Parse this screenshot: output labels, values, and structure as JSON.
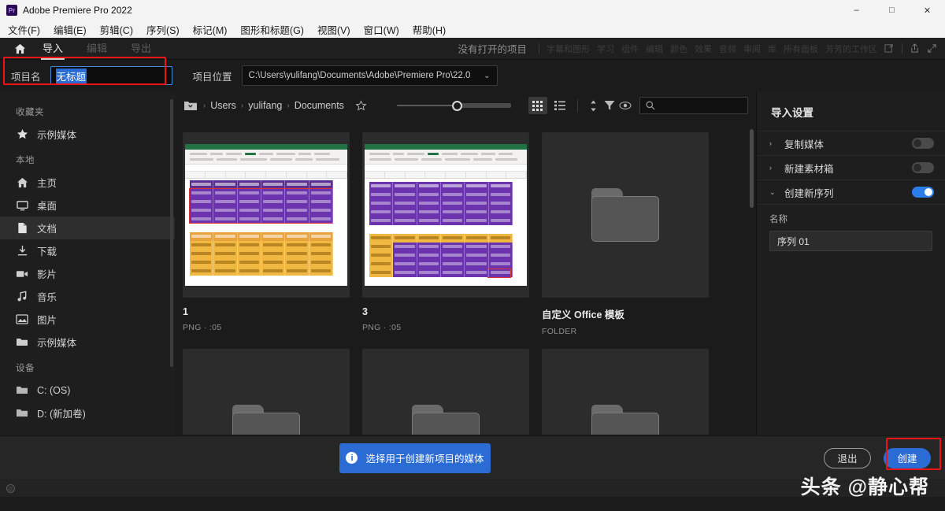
{
  "window": {
    "title": "Adobe Premiere Pro 2022",
    "logo_text": "Pr",
    "minimize": "–",
    "maximize": "□",
    "close": "✕"
  },
  "menubar": {
    "items": [
      "文件(F)",
      "编辑(E)",
      "剪辑(C)",
      "序列(S)",
      "标记(M)",
      "图形和标题(G)",
      "视图(V)",
      "窗口(W)",
      "帮助(H)"
    ]
  },
  "navbar": {
    "home_icon": "home-icon",
    "tabs": [
      {
        "label": "导入",
        "active": true
      },
      {
        "label": "编辑",
        "active": false
      },
      {
        "label": "导出",
        "active": false
      }
    ],
    "no_project_text": "没有打开的项目",
    "workspaces": [
      "字幕和图形",
      "学习",
      "组件",
      "编辑",
      "颜色",
      "效果",
      "音频",
      "审阅",
      "库",
      "所有面板",
      "芳芳的工作区"
    ]
  },
  "project_row": {
    "name_label": "项目名",
    "name_value": "无标题",
    "location_label": "项目位置",
    "location_value": "C:\\Users\\yulifang\\Documents\\Adobe\\Premiere Pro\\22.0",
    "location_chevron": "⌄"
  },
  "sidebar": {
    "sections": [
      {
        "header": "收藏夹",
        "items": [
          {
            "label": "示例媒体",
            "icon": "star-icon",
            "active": false
          }
        ]
      },
      {
        "header": "本地",
        "items": [
          {
            "label": "主页",
            "icon": "home-icon",
            "active": false
          },
          {
            "label": "桌面",
            "icon": "monitor-icon",
            "active": false
          },
          {
            "label": "文档",
            "icon": "document-icon",
            "active": true
          },
          {
            "label": "下载",
            "icon": "download-icon",
            "active": false
          },
          {
            "label": "影片",
            "icon": "video-camera-icon",
            "active": false
          },
          {
            "label": "音乐",
            "icon": "music-note-icon",
            "active": false
          },
          {
            "label": "图片",
            "icon": "image-icon",
            "active": false
          },
          {
            "label": "示例媒体",
            "icon": "folder-icon",
            "active": false
          }
        ]
      },
      {
        "header": "设备",
        "items": [
          {
            "label": "C: (OS)",
            "icon": "folder-icon",
            "active": false
          },
          {
            "label": "D: (新加卷)",
            "icon": "folder-icon",
            "active": false
          }
        ]
      }
    ]
  },
  "browser": {
    "breadcrumb": {
      "folder_icon": "folder-dropdown-icon",
      "parts": [
        "Users",
        "yulifang",
        "Documents"
      ],
      "separator": "›",
      "star_icon": "star-outline-icon"
    },
    "zoom_slider": {
      "value": 45
    },
    "view_grid_icon": "grid-view-icon",
    "view_list_icon": "list-view-icon",
    "sort_icon": "sort-icon",
    "filter_icon": "filter-icon",
    "preview_icon": "eye-icon",
    "search": {
      "icon": "search-icon",
      "value": "",
      "placeholder": ""
    },
    "items": [
      {
        "name": "1",
        "meta": "PNG · :05",
        "kind": "excel-thumb-1"
      },
      {
        "name": "3",
        "meta": "PNG · :05",
        "kind": "excel-thumb-2"
      },
      {
        "name": "自定义 Office 模板",
        "meta": "FOLDER",
        "kind": "folder"
      },
      {
        "name": "",
        "meta": "",
        "kind": "folder"
      },
      {
        "name": "",
        "meta": "",
        "kind": "folder"
      },
      {
        "name": "",
        "meta": "",
        "kind": "folder"
      }
    ]
  },
  "import_settings": {
    "title": "导入设置",
    "rows": [
      {
        "label": "复制媒体",
        "chevron": "›",
        "toggle": false
      },
      {
        "label": "新建素材箱",
        "chevron": "›",
        "toggle": false
      },
      {
        "label": "创建新序列",
        "chevron": "⌄",
        "toggle": true
      }
    ],
    "sequence_name_label": "名称",
    "sequence_name_value": "序列 01"
  },
  "bottom": {
    "info_icon": "info-icon",
    "info_text": "选择用于创建新项目的媒体",
    "exit_label": "退出",
    "create_label": "创建"
  },
  "watermark": "头条 @静心帮",
  "colors": {
    "accent_blue": "#2b6cd4",
    "highlight_red": "#f01414",
    "toggle_on": "#2b7de9",
    "selection_blue": "#2b6cd4"
  }
}
